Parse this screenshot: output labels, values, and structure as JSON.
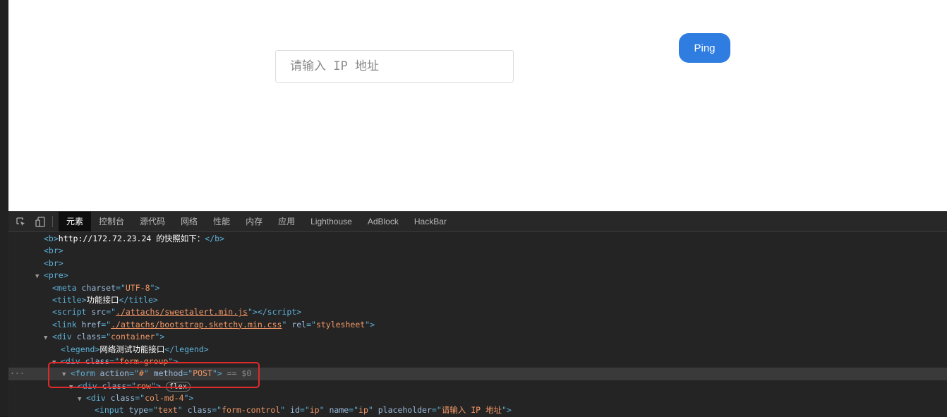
{
  "page": {
    "ip_placeholder": "请输入 IP 地址",
    "ping_label": "Ping"
  },
  "devtools": {
    "tabs": [
      "元素",
      "控制台",
      "源代码",
      "网络",
      "性能",
      "内存",
      "应用",
      "Lighthouse",
      "AdBlock",
      "HackBar"
    ],
    "lines": {
      "l1_text": "http://172.72.23.24 的快照如下：",
      "meta_charset": "UTF-8",
      "title_text": "功能接口",
      "script_src": "./attachs/sweetalert.min.js",
      "link_href": "./attachs/bootstrap.sketchy.min.css",
      "link_rel": "stylesheet",
      "div_container": "container",
      "legend_text": "网络测试功能接口",
      "div_form_group": "form-group",
      "form_action": "#",
      "form_method": "POST",
      "form_suffix": " == $0",
      "div_row": "row",
      "flex_badge": "flex",
      "div_col": "col-md-4",
      "input_type": "text",
      "input_class": "form-control",
      "input_id": "ip",
      "input_name": "ip",
      "input_placeholder": "请输入 IP 地址"
    }
  },
  "colors": {
    "accent": "#2f7de1",
    "highlight": "#e02a2a"
  }
}
